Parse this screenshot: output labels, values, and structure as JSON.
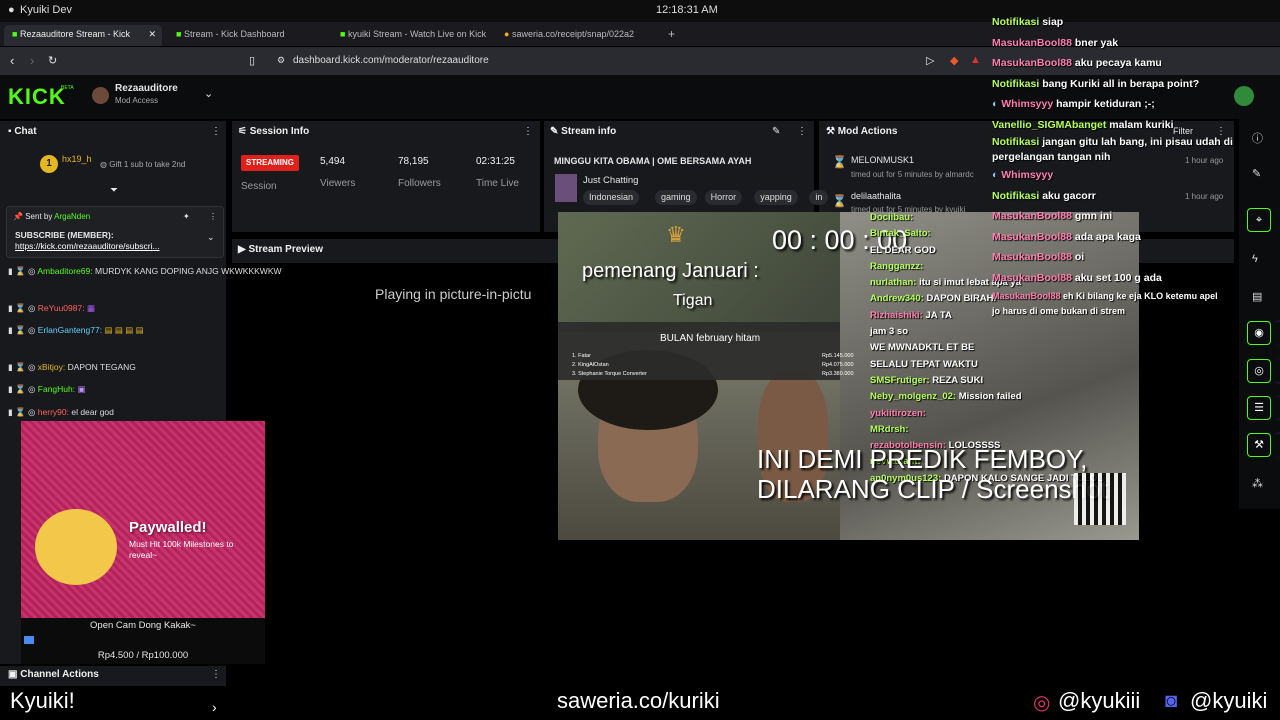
{
  "os": {
    "app_name": "Kyuiki Dev",
    "clock": "12:18:31 AM"
  },
  "tabs": [
    {
      "label": "Rezaauditore Stream - Kick"
    },
    {
      "label": "Stream - Kick Dashboard"
    },
    {
      "label": "kyuiki Stream - Watch Live on Kick"
    },
    {
      "label": "saweria.co/receipt/snap/022a2"
    }
  ],
  "browser": {
    "url": "dashboard.kick.com/moderator/rezaauditore"
  },
  "kick": {
    "logo": "KICK",
    "logo_badge": "BETA",
    "channel_name": "Rezaauditore",
    "channel_access": "Mod Access"
  },
  "chat_panel": {
    "title": "Chat",
    "gift_user": "hx19_h",
    "gift_rank": "1",
    "gift_text": "Gift 1 sub to take 2nd",
    "pinned_by_label": "Sent by",
    "pinned_user": "ArgaNden",
    "pinned_text": "SUBSCRIBE (MEMBER):",
    "pinned_link": "https://kick.com/rezaauditore/subscri...",
    "messages": [
      {
        "user": "Ambaditore69:",
        "text": "MURDYK KANG DOPING ANJG WKWKKKWKW"
      },
      {
        "user": "ReYuu0987:",
        "text": ""
      },
      {
        "user": "ErlanGanteng77:",
        "text": ""
      },
      {
        "user": "xBitjoy:",
        "text": "DAPON TEGANG"
      },
      {
        "user": "FangHuh:",
        "text": ""
      },
      {
        "user": "herry90:",
        "text": "el dear god"
      }
    ]
  },
  "stream_info_panel": {
    "title": "Session Info",
    "badge": "STREAMING",
    "session_label": "Session",
    "viewers": "5,494",
    "viewers_label": "Viewers",
    "followers": "78,195",
    "followers_label": "Followers",
    "time_live": "02:31:25",
    "time_live_label": "Time Live"
  },
  "stream_details": {
    "title": "Stream info",
    "stream_title": "MINGGU KITA OBAMA | OME BERSAMA AYAH",
    "category": "Just Chatting",
    "tags": [
      "Indonesian",
      "gaming",
      "Horror",
      "yapping",
      "in"
    ]
  },
  "mod_actions": {
    "title": "Mod Actions",
    "filter_label": "Filter",
    "items": [
      {
        "user": "MELONMUSK1",
        "detail": "timed out for 5 minutes by almardc"
      },
      {
        "user": "delilaathalita",
        "detail": "timed out for 5 minutes by kyuiki"
      }
    ],
    "times": [
      "1 hour ago",
      "1 hour ago"
    ]
  },
  "preview": {
    "title": "Stream Preview",
    "pip_text": "Playing in picture-in-pictu"
  },
  "channel_actions": {
    "title": "Channel Actions"
  },
  "stream_overlay": {
    "timer": "00 : 00 : 00",
    "winner_title": "pemenang Januari :",
    "winner_name": "Tigan",
    "board_title": "BULAN february hitam",
    "board_rows": [
      "1. Fatar",
      "2. KingAlOstan",
      "3. Stephanie Torque Converter"
    ],
    "board_amounts": [
      "Rp5.145.000",
      "Rp4.075.000",
      "Rp3.380.000"
    ],
    "overlay_line1": "INI DEMI PREDIK FEMBOY,",
    "overlay_line2": "DILARANG CLIP / Screenshot",
    "chat": [
      {
        "user": "Dociibau:",
        "text": ""
      },
      {
        "user": "Bintak_Salto:",
        "text": ""
      },
      {
        "user": "",
        "text": "EL DEAR GOD"
      },
      {
        "user": "Rangganzz:",
        "text": ""
      },
      {
        "user": "nurlathan:",
        "text": "itu si imut lebat apa ya"
      },
      {
        "user": "Andrew340:",
        "text": "DAPON BIRAHI"
      },
      {
        "user": "Rizhaishiki:",
        "text": "JA TA"
      },
      {
        "user": "",
        "text": "jam 3 so"
      },
      {
        "user": "",
        "text": "WE MWNADKTL ET BE"
      },
      {
        "user": "",
        "text": "SELALU TEPAT WAKTU"
      },
      {
        "user": "SMSFrutiger:",
        "text": "REZA SUKI"
      },
      {
        "user": "Neby_molgenz_02:",
        "text": "Mission failed"
      },
      {
        "user": "yukiitirozen:",
        "text": ""
      },
      {
        "user": "MRdrsh:",
        "text": ""
      },
      {
        "user": "rezabotolbensin:",
        "text": "LOLOSSSS"
      },
      {
        "user": "nevvariant:",
        "text": ""
      },
      {
        "user": "an0nym0us123:",
        "text": "DAPON KALO SANGE JADI TOLOL"
      }
    ]
  },
  "paywall": {
    "title": "Paywalled!",
    "subtitle": "Must Hit 100k Milestones to reveal~",
    "caption": "Open Cam Dong Kakak~",
    "amount": "Rp4.500 / Rp100.000"
  },
  "overlay_chat": [
    {
      "user": "Notifikasi",
      "text": "siap",
      "cls": "lime"
    },
    {
      "user": "MasukanBool88",
      "text": "bner yak",
      "cls": "pink"
    },
    {
      "user": "MasukanBool88",
      "text": "aku pecaya kamu",
      "cls": "pink"
    },
    {
      "user": "Notifikasi",
      "text": "bang Kuriki all in berapa point?",
      "cls": "lime"
    },
    {
      "user": "Whimsyyy",
      "text": "hampir ketiduran ;-;",
      "cls": "blue"
    },
    {
      "user": "Vanellio_SIGMAbanget",
      "text": "malam kuriki",
      "cls": "lime"
    },
    {
      "user": "Notifikasi",
      "text": "jangan gitu lah bang, ini pisau udah di",
      "cls": "lime"
    },
    {
      "user": "",
      "text": "pergelangan tangan nih",
      "cls": "lime"
    },
    {
      "user": "Whimsyyy",
      "text": "",
      "cls": "blue"
    },
    {
      "user": "Notifikasi",
      "text": "aku gacorr",
      "cls": "lime"
    },
    {
      "user": "MasukanBool88",
      "text": "gmn ini",
      "cls": "pink"
    },
    {
      "user": "MasukanBool88",
      "text": "ada apa kaga",
      "cls": "pink"
    },
    {
      "user": "MasukanBool88",
      "text": "oi",
      "cls": "pink"
    },
    {
      "user": "MasukanBool88",
      "text": "aku set 100 g ada",
      "cls": "pink"
    },
    {
      "user": "MasukanBool88",
      "text": "eh Ki bilang ke eja KLO ketemu apel",
      "cls": "pink"
    },
    {
      "user": "",
      "text": "jo harus di ome bukan di strem",
      "cls": "pink"
    }
  ],
  "footer": {
    "left": "Kyuiki!",
    "center": "saweria.co/kuriki",
    "instagram": "@kyukiii",
    "discord": "@kyuiki"
  }
}
